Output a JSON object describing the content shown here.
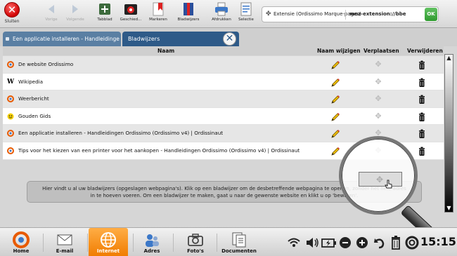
{
  "toolbar": {
    "close_label": "Sluiten",
    "buttons": [
      {
        "label": "Vorige",
        "enabled": false
      },
      {
        "label": "Volgende",
        "enabled": false
      },
      {
        "label": "Tabblad",
        "enabled": true
      },
      {
        "label": "Geschied...",
        "enabled": true
      },
      {
        "label": "Markeren",
        "enabled": true
      },
      {
        "label": "Bladwijzers",
        "enabled": true
      },
      {
        "label": "Afdrukken",
        "enabled": true
      },
      {
        "label": "Selectie",
        "enabled": true
      }
    ],
    "address": {
      "title": "Extensie (Ordissimo Marque-pages)",
      "url": "moz-extension://bbe",
      "ok_label": "OK"
    }
  },
  "tabs": [
    {
      "label": "Een applicatie installeren - Handleidinge",
      "active": false
    },
    {
      "label": "Bladwijzers",
      "active": true
    }
  ],
  "table": {
    "headers": {
      "name": "Naam",
      "rename": "Naam wijzigen",
      "move": "Verplaatsen",
      "delete": "Verwijderen"
    },
    "rows": [
      {
        "name": "De website Ordissimo",
        "icon": "ordissimo-icon"
      },
      {
        "name": "Wikipedia",
        "icon": "wikipedia-icon"
      },
      {
        "name": "Weerbericht",
        "icon": "ordissimo-icon"
      },
      {
        "name": "Gouden Gids",
        "icon": "smiley-icon"
      },
      {
        "name": "Een applicatie installeren - Handleidingen Ordissimo (Ordissimo v4) | Ordissinaut",
        "icon": "ordissimo-icon"
      },
      {
        "name": "Tips voor het kiezen van een printer voor het aankopen - Handleidingen Ordissimo (Ordissimo v4) | Ordissinaut",
        "icon": "ordissimo-icon"
      }
    ]
  },
  "info": {
    "text": "Hier vindt u al uw bladwijzers (opgeslagen webpagina's). Klik op een bladwijzer om de desbetreffende webpagina te openen, zonder het hele adres in te hoeven voeren. Om een bladwijzer te maken, gaat u naar de gewenste website en klikt u op 'bewaren'."
  },
  "bottombar": {
    "apps": [
      {
        "label": "Home"
      },
      {
        "label": "E-mail"
      },
      {
        "label": "Internet",
        "active": true
      },
      {
        "label": "Adres"
      },
      {
        "label": "Foto's"
      },
      {
        "label": "Documenten"
      }
    ],
    "clock": "15:15"
  },
  "colors": {
    "accent_orange": "#f07c00",
    "tab_active": "#2e5a88",
    "close_red": "#d00000"
  }
}
